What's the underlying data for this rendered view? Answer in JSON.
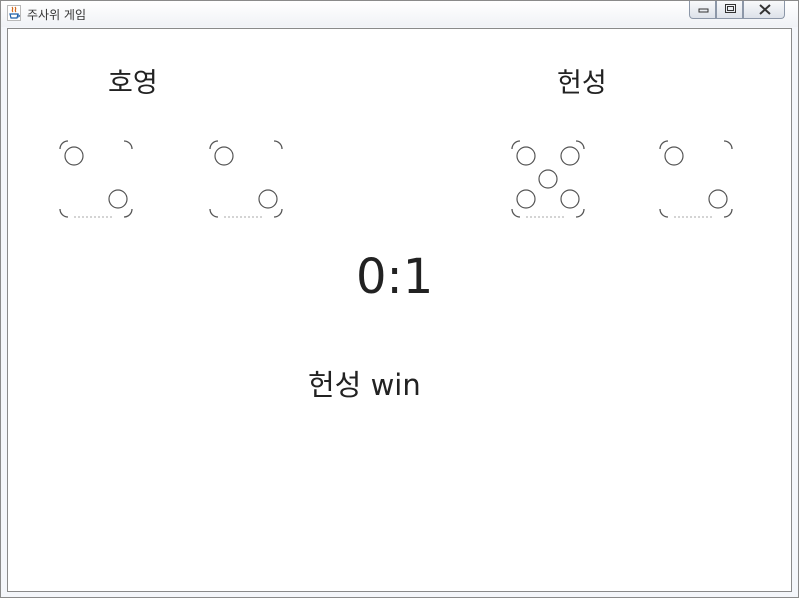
{
  "window": {
    "title": "주사위 게임",
    "icon": "java-icon",
    "controls": [
      "minimize-icon",
      "maximize-icon",
      "close-icon"
    ]
  },
  "players": [
    {
      "name": "호영",
      "dice": [
        2,
        2
      ]
    },
    {
      "name": "헌성",
      "dice": [
        5,
        2
      ]
    }
  ],
  "score": "0:1",
  "result": "헌성 win"
}
